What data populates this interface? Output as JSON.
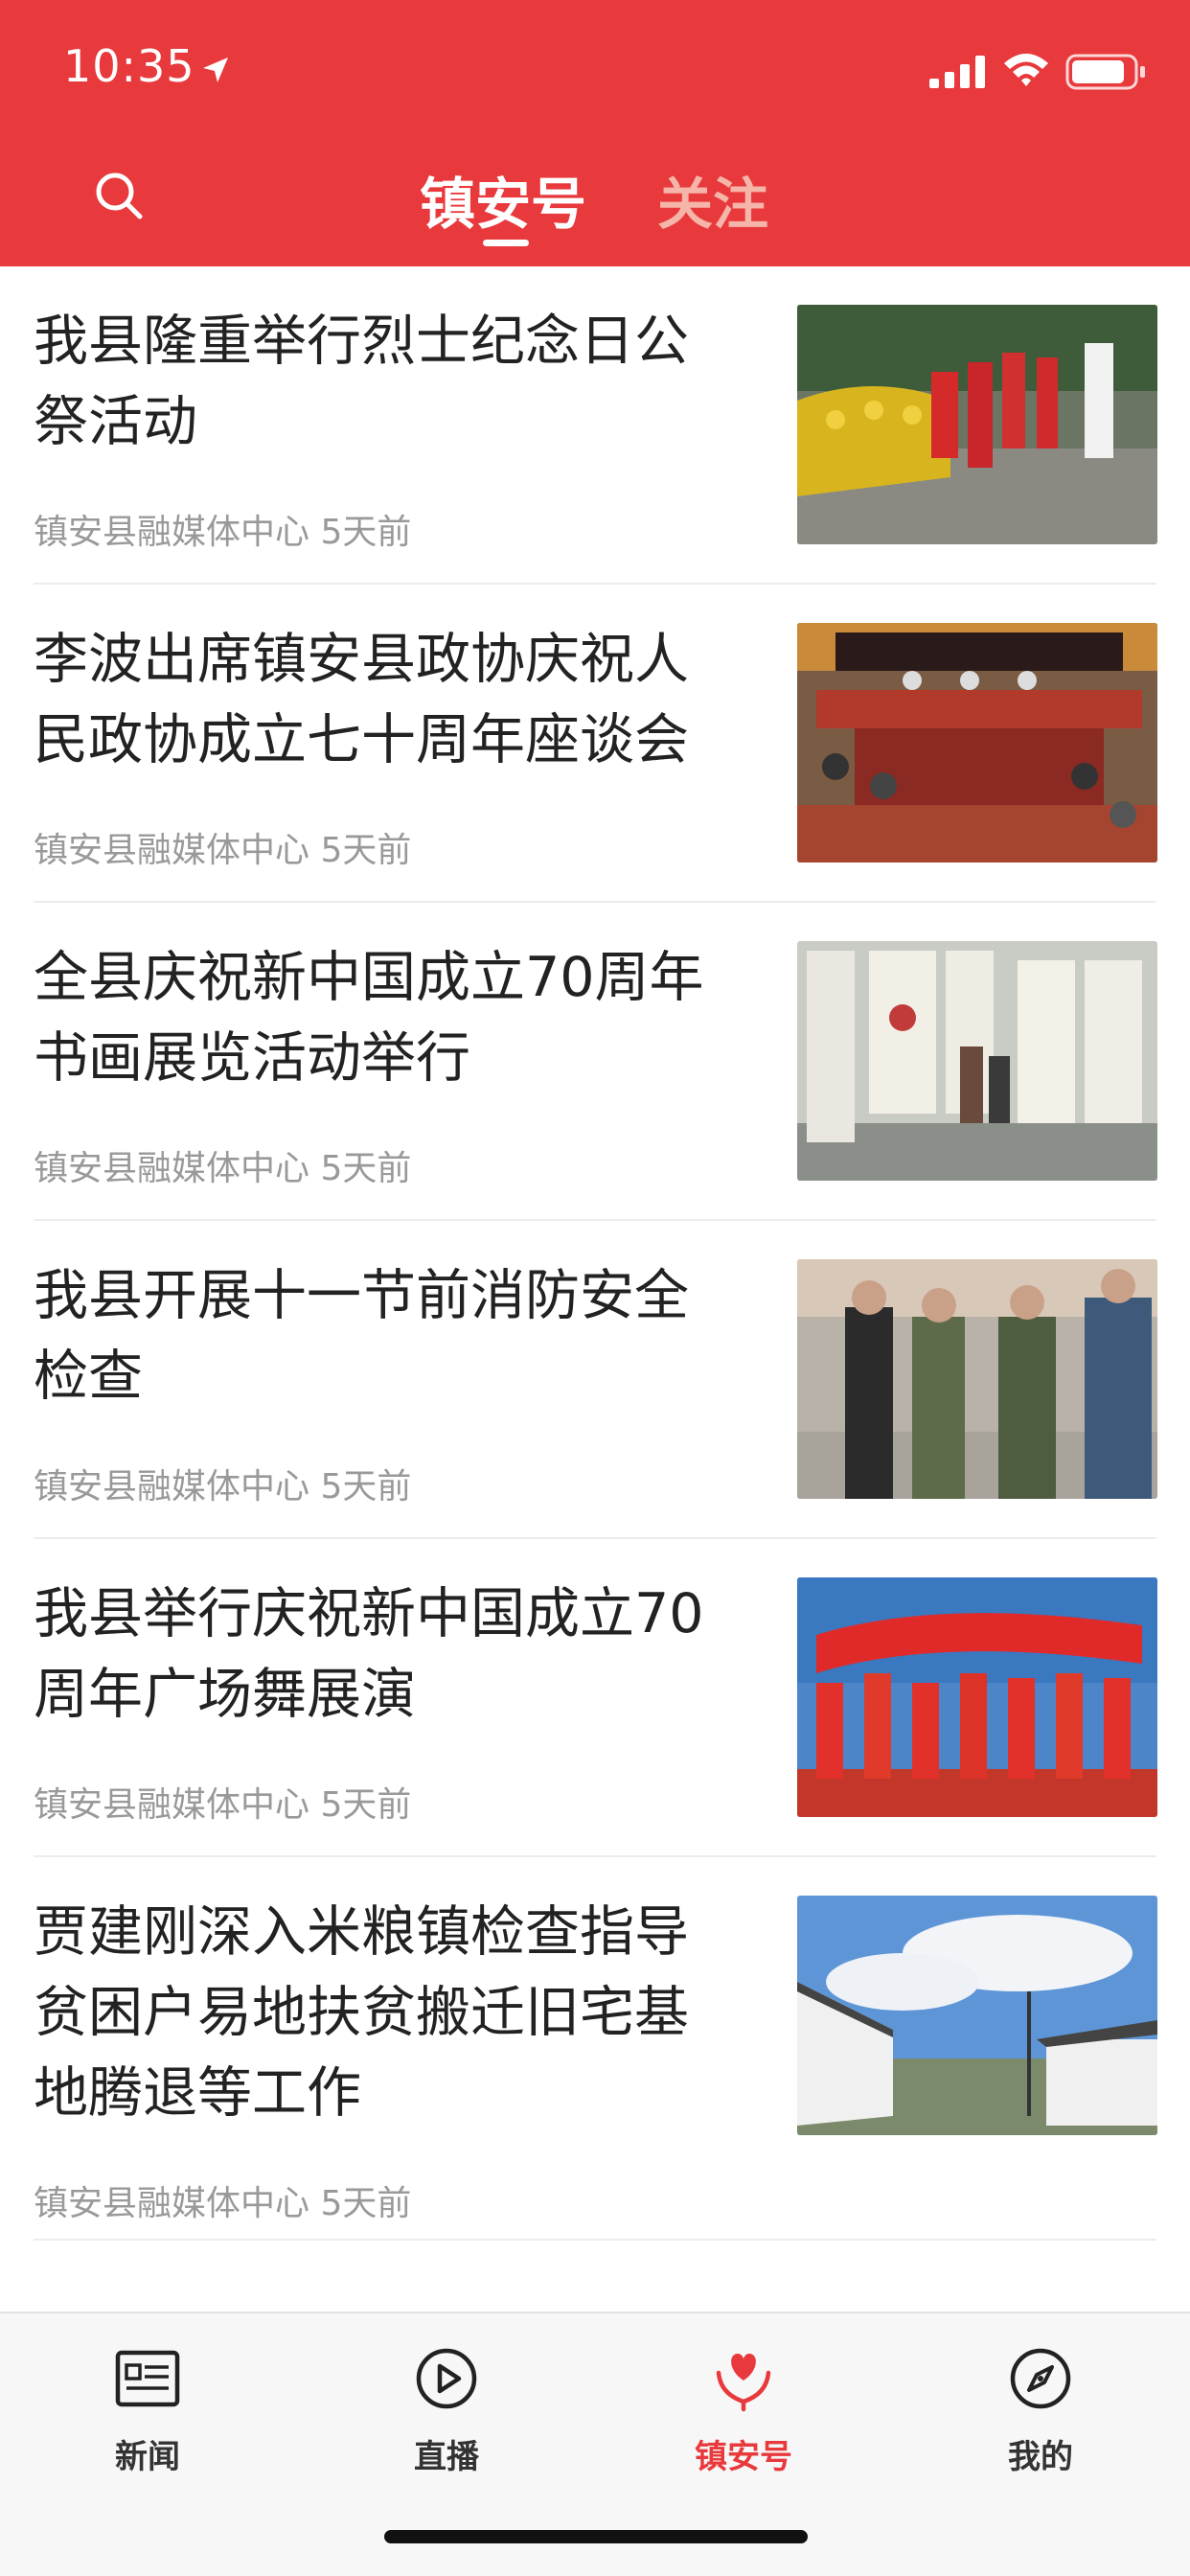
{
  "status_bar": {
    "time": "10:35"
  },
  "header": {
    "tabs": [
      {
        "label": "镇安号",
        "active": true
      },
      {
        "label": "关注",
        "active": false
      }
    ]
  },
  "articles": [
    {
      "title": "我县隆重举行烈士纪念日公祭活动",
      "source": "镇安县融媒体中心",
      "time": "5天前",
      "image": "memorial-ceremony-photo"
    },
    {
      "title": "李波出席镇安县政协庆祝人民政协成立七十周年座谈会",
      "source": "镇安县融媒体中心",
      "time": "5天前",
      "image": "conference-meeting-photo"
    },
    {
      "title": "全县庆祝新中国成立70周年书画展览活动举行",
      "source": "镇安县融媒体中心",
      "time": "5天前",
      "image": "calligraphy-exhibition-photo"
    },
    {
      "title": "我县开展十一节前消防安全检查",
      "source": "镇安县融媒体中心",
      "time": "5天前",
      "image": "fire-safety-inspection-photo"
    },
    {
      "title": "我县举行庆祝新中国成立70周年广场舞展演",
      "source": "镇安县融媒体中心",
      "time": "5天前",
      "image": "square-dance-photo"
    },
    {
      "title": "贾建刚深入米粮镇检查指导贫困户易地扶贫搬迁旧宅基地腾退等工作",
      "source": "镇安县融媒体中心",
      "time": "5天前",
      "image": "village-houses-photo"
    }
  ],
  "tabbar": {
    "items": [
      {
        "label": "新闻",
        "icon": "newspaper-icon",
        "active": false
      },
      {
        "label": "直播",
        "icon": "play-icon",
        "active": false
      },
      {
        "label": "镇安号",
        "icon": "heart-hands-icon",
        "active": true
      },
      {
        "label": "我的",
        "icon": "compass-icon",
        "active": false
      }
    ]
  },
  "colors": {
    "brand_red": "#e8393c",
    "inactive_tab": "#f5b5a8",
    "meta_gray": "#999999"
  }
}
